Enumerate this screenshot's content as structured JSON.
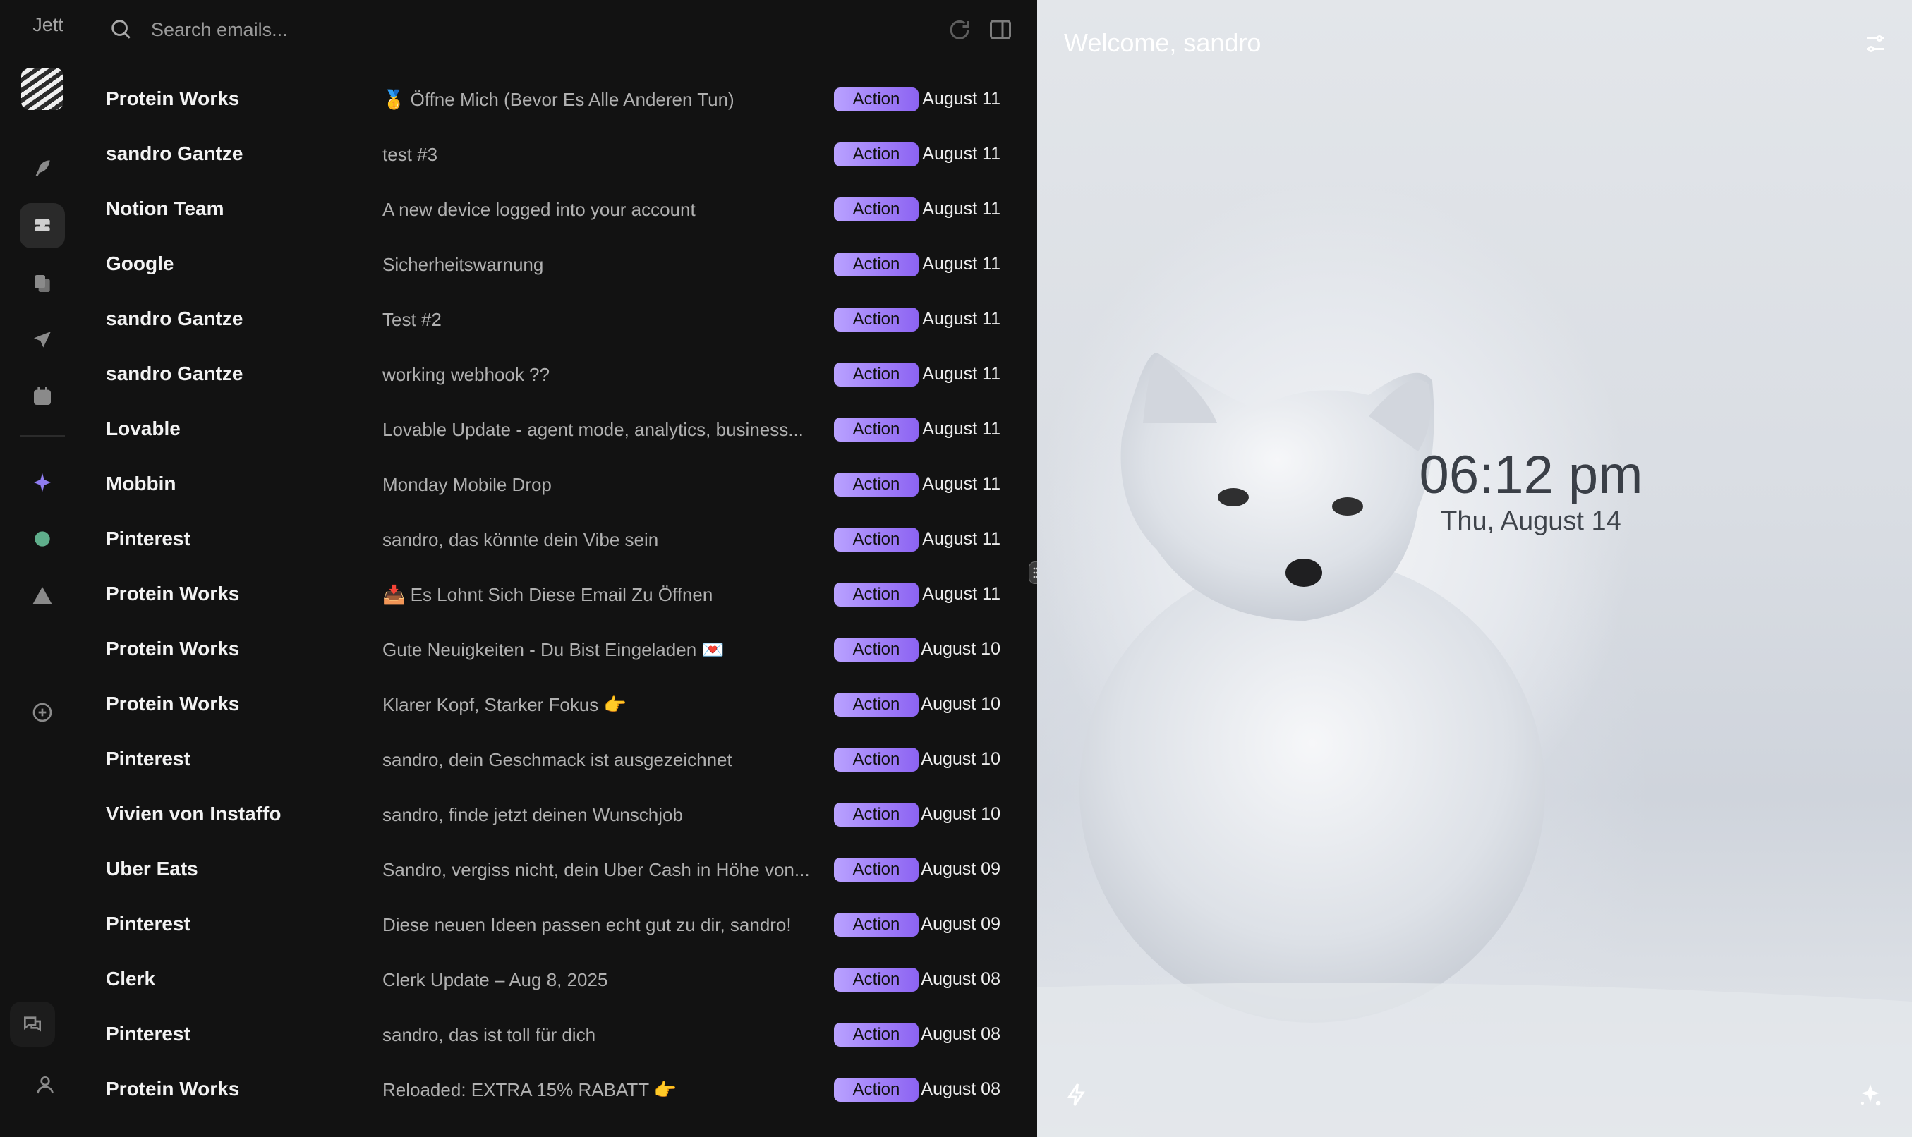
{
  "app": {
    "brand": "Jett"
  },
  "search": {
    "placeholder": "Search emails..."
  },
  "emails": [
    {
      "sender": "Protein Works",
      "subject": "🥇 Öffne Mich (Bevor Es Alle Anderen Tun)",
      "tag": "Action",
      "date": "August 11"
    },
    {
      "sender": "sandro Gantze",
      "subject": "test #3",
      "tag": "Action",
      "date": "August 11"
    },
    {
      "sender": "Notion Team",
      "subject": "A new device logged into your account",
      "tag": "Action",
      "date": "August 11"
    },
    {
      "sender": "Google",
      "subject": "Sicherheitswarnung",
      "tag": "Action",
      "date": "August 11"
    },
    {
      "sender": "sandro Gantze",
      "subject": "Test #2",
      "tag": "Action",
      "date": "August 11"
    },
    {
      "sender": "sandro Gantze",
      "subject": "working webhook ??",
      "tag": "Action",
      "date": "August 11"
    },
    {
      "sender": "Lovable",
      "subject": "Lovable Update - agent mode, analytics, business...",
      "tag": "Action",
      "date": "August 11"
    },
    {
      "sender": "Mobbin",
      "subject": "Monday Mobile Drop",
      "tag": "Action",
      "date": "August 11"
    },
    {
      "sender": "Pinterest",
      "subject": "sandro, das könnte dein Vibe sein",
      "tag": "Action",
      "date": "August 11"
    },
    {
      "sender": "Protein Works",
      "subject": "📥 Es Lohnt Sich Diese Email Zu Öffnen",
      "tag": "Action",
      "date": "August 11"
    },
    {
      "sender": "Protein Works",
      "subject": "Gute Neuigkeiten - Du Bist Eingeladen 💌",
      "tag": "Action",
      "date": "August 10"
    },
    {
      "sender": "Protein Works",
      "subject": "Klarer Kopf, Starker Fokus 👉",
      "tag": "Action",
      "date": "August 10"
    },
    {
      "sender": "Pinterest",
      "subject": "sandro, dein Geschmack ist ausgezeichnet",
      "tag": "Action",
      "date": "August 10"
    },
    {
      "sender": "Vivien von Instaffo",
      "subject": "sandro, finde jetzt deinen Wunschjob",
      "tag": "Action",
      "date": "August 10"
    },
    {
      "sender": "Uber Eats",
      "subject": "Sandro, vergiss nicht, dein Uber Cash in Höhe von...",
      "tag": "Action",
      "date": "August 09"
    },
    {
      "sender": "Pinterest",
      "subject": "Diese neuen Ideen passen echt gut zu dir, sandro!",
      "tag": "Action",
      "date": "August 09"
    },
    {
      "sender": "Clerk",
      "subject": "Clerk Update – Aug 8, 2025",
      "tag": "Action",
      "date": "August 08"
    },
    {
      "sender": "Pinterest",
      "subject": "sandro, das ist toll für dich",
      "tag": "Action",
      "date": "August 08"
    },
    {
      "sender": "Protein Works",
      "subject": "Reloaded: EXTRA 15% RABATT 👉",
      "tag": "Action",
      "date": "August 08"
    }
  ],
  "hero": {
    "welcome": "Welcome, sandro",
    "time": "06:12 pm",
    "date": "Thu, August 14"
  },
  "colors": {
    "accent_start": "#b9a2ff",
    "accent_end": "#8c63f2",
    "background": "#121212"
  },
  "icons": [
    "search-icon",
    "refresh-icon",
    "panel-toggle-icon",
    "feather-icon",
    "inbox-icon",
    "files-icon",
    "send-icon",
    "calendar-icon",
    "sparkle-icon",
    "chat-bubble-icon",
    "warning-icon",
    "add-icon",
    "messages-icon",
    "user-icon",
    "settings-sliders-icon",
    "bolt-icon",
    "magic-icon"
  ]
}
